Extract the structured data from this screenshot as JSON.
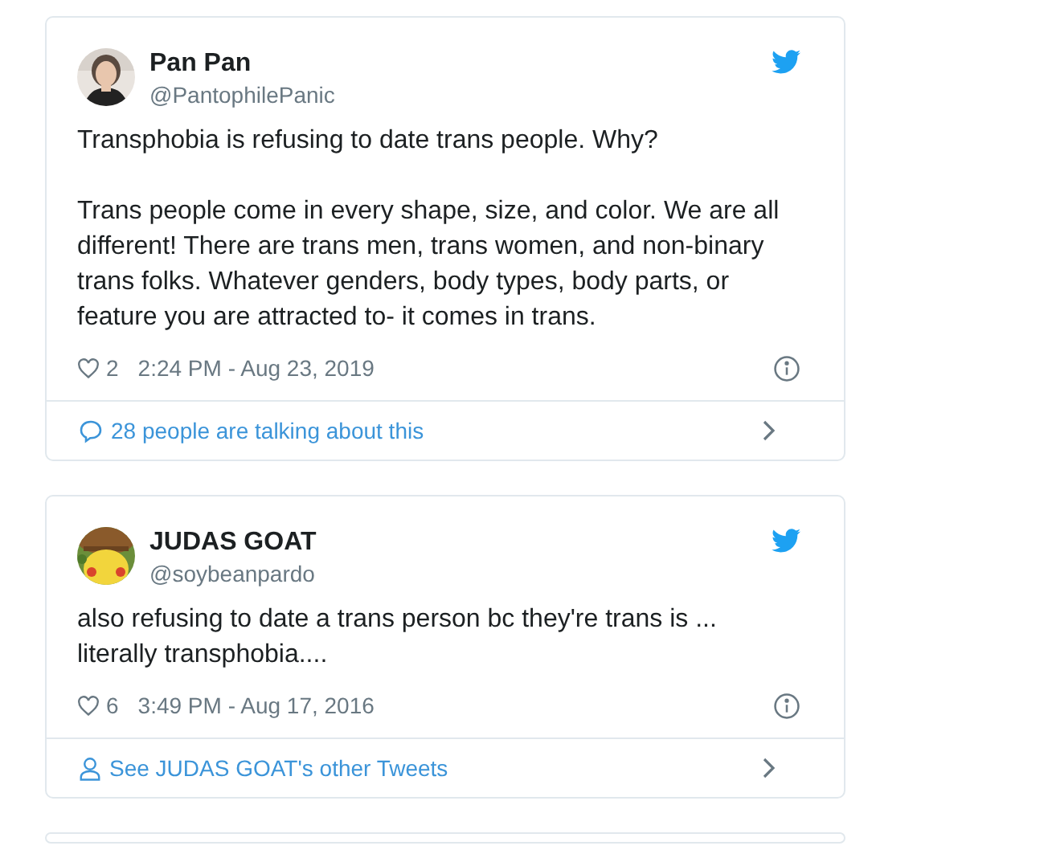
{
  "tweets": [
    {
      "name": "Pan Pan",
      "handle": "@PantophilePanic",
      "avatar": {
        "kind": "picture"
      },
      "paragraphs": [
        "Transphobia is refusing to date trans people. Why?",
        "Trans people come in every shape, size, and color. We are all different! There are trans men, trans women, and non-binary trans folks. Whatever genders, body types, body parts, or feature you are attracted to- it comes in trans."
      ],
      "likes": "2",
      "time": "2:24 PM - Aug 23, 2019",
      "link": {
        "kind": "talking",
        "label": "28 people are talking about this"
      }
    },
    {
      "name": "JUDAS GOAT",
      "handle": "@soybeanpardo",
      "avatar": {
        "kind": "picture"
      },
      "paragraphs": [
        "also refusing to date a trans person bc they're trans is ... literally transphobia...."
      ],
      "likes": "6",
      "time": "3:49 PM - Aug 17, 2016",
      "link": {
        "kind": "profile",
        "label": "See JUDAS GOAT's other Tweets"
      }
    }
  ]
}
